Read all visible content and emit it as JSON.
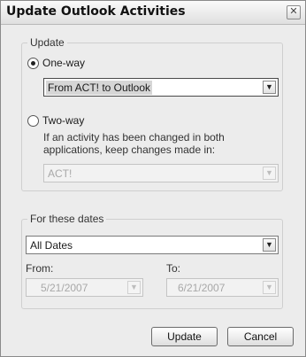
{
  "window": {
    "title": "Update Outlook Activities",
    "close_glyph": "✕"
  },
  "update_group": {
    "legend": "Update",
    "one_way_label": "One-way",
    "one_way_checked": true,
    "one_way_direction": "From ACT! to Outlook",
    "two_way_label": "Two-way",
    "two_way_checked": false,
    "conflict_note": "If an activity has been changed in both applications, keep changes made in:",
    "keep_changes_value": "ACT!"
  },
  "dates_group": {
    "legend": "For these dates",
    "range_value": "All Dates",
    "from_label": "From:",
    "from_value": "5/21/2007",
    "to_label": "To:",
    "to_value": "6/21/2007"
  },
  "buttons": {
    "update": "Update",
    "cancel": "Cancel"
  },
  "icons": {
    "dropdown": "chevron-down-icon",
    "close": "close-icon"
  }
}
